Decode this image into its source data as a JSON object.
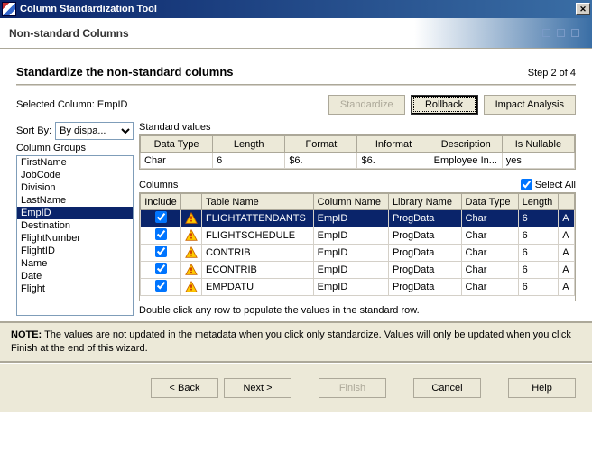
{
  "titlebar": {
    "title": "Column Standardization Tool",
    "close_tooltip": "Close"
  },
  "header_band": {
    "title": "Non-standard Columns"
  },
  "step": {
    "title": "Standardize the non-standard columns",
    "num": "Step 2 of 4"
  },
  "selected_col": {
    "label": "Selected Column: EmpID"
  },
  "buttons": {
    "standardize": "Standardize",
    "rollback": "Rollback",
    "impact": "Impact Analysis"
  },
  "sortby": {
    "label": "Sort By:",
    "value": "By dispa..."
  },
  "column_groups": {
    "label": "Column Groups",
    "items": [
      "FirstName",
      "JobCode",
      "Division",
      "LastName",
      "EmpID",
      "Destination",
      "FlightNumber",
      "FlightID",
      "Name",
      "Date",
      "Flight"
    ],
    "selected": "EmpID"
  },
  "standard_values": {
    "label": "Standard values",
    "headers": [
      "Data Type",
      "Length",
      "Format",
      "Informat",
      "Description",
      "Is Nullable"
    ],
    "row": [
      "Char",
      "6",
      "$6.",
      "$6.",
      "Employee In...",
      "yes"
    ]
  },
  "columns": {
    "label": "Columns",
    "select_all_label": "Select All",
    "select_all_checked": true,
    "headers": [
      "Include",
      "",
      "Table Name",
      "Column Name",
      "Library Name",
      "Data Type",
      "Length",
      ""
    ],
    "rows": [
      {
        "include": true,
        "selected": true,
        "table": "FLIGHTATTENDANTS",
        "col": "EmpID",
        "lib": "ProgData",
        "dtype": "Char",
        "len": "6",
        "tail": "A"
      },
      {
        "include": true,
        "selected": false,
        "table": "FLIGHTSCHEDULE",
        "col": "EmpID",
        "lib": "ProgData",
        "dtype": "Char",
        "len": "6",
        "tail": "A"
      },
      {
        "include": true,
        "selected": false,
        "table": "CONTRIB",
        "col": "EmpID",
        "lib": "ProgData",
        "dtype": "Char",
        "len": "6",
        "tail": "A"
      },
      {
        "include": true,
        "selected": false,
        "table": "ECONTRIB",
        "col": "EmpID",
        "lib": "ProgData",
        "dtype": "Char",
        "len": "6",
        "tail": "A"
      },
      {
        "include": true,
        "selected": false,
        "table": "EMPDATU",
        "col": "EmpID",
        "lib": "ProgData",
        "dtype": "Char",
        "len": "6",
        "tail": "A"
      }
    ]
  },
  "hint": "Double click any row to populate the values in the standard row.",
  "note": {
    "bold": "NOTE:",
    "text": " The values are not updated in the metadata when you click only standardize. Values will only be updated when you click Finish at the end of this wizard."
  },
  "footer": {
    "back": "< Back",
    "next": "Next >",
    "finish": "Finish",
    "cancel": "Cancel",
    "help": "Help"
  }
}
